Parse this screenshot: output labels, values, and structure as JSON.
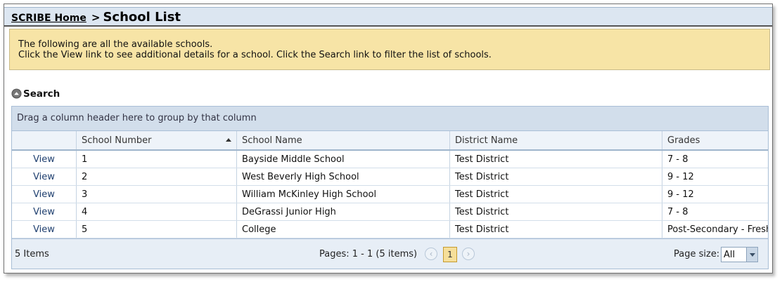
{
  "breadcrumb": {
    "home_link": "SCRIBE Home",
    "separator": ">",
    "current": "School List"
  },
  "info": {
    "line1": "The following are all the available schools.",
    "line2": "Click the View link to see additional details for a school. Click the Search link to filter the list of schools."
  },
  "search": {
    "label": "Search",
    "icon": "collapse-up-circle-icon"
  },
  "grid": {
    "group_panel_text": "Drag a column header here to group by that column",
    "columns": [
      "",
      "School Number",
      "School Name",
      "District Name",
      "Grades"
    ],
    "sort": {
      "column": "School Number",
      "direction": "ascending"
    },
    "rows": [
      {
        "action": "View",
        "number": "1",
        "name": "Bayside Middle School",
        "district": "Test District",
        "grades": "7 - 8"
      },
      {
        "action": "View",
        "number": "2",
        "name": "West Beverly High School",
        "district": "Test District",
        "grades": "9 - 12"
      },
      {
        "action": "View",
        "number": "3",
        "name": "William McKinley High School",
        "district": "Test District",
        "grades": "9 - 12"
      },
      {
        "action": "View",
        "number": "4",
        "name": "DeGrassi Junior High",
        "district": "Test District",
        "grades": "7 - 8"
      },
      {
        "action": "View",
        "number": "5",
        "name": "College",
        "district": "Test District",
        "grades": "Post-Secondary - Freshman"
      }
    ]
  },
  "footer": {
    "items_count": "5 Items",
    "pager_summary": "Pages: 1 - 1 (5 items)",
    "current_page": "1",
    "page_size_label": "Page size:",
    "page_size_value": "All"
  },
  "colors": {
    "header_bg": "#dce6f1",
    "info_bg": "#f7e4a6",
    "grid_header_bg": "#eef3f9",
    "active_page_bg": "#f6df9a"
  }
}
